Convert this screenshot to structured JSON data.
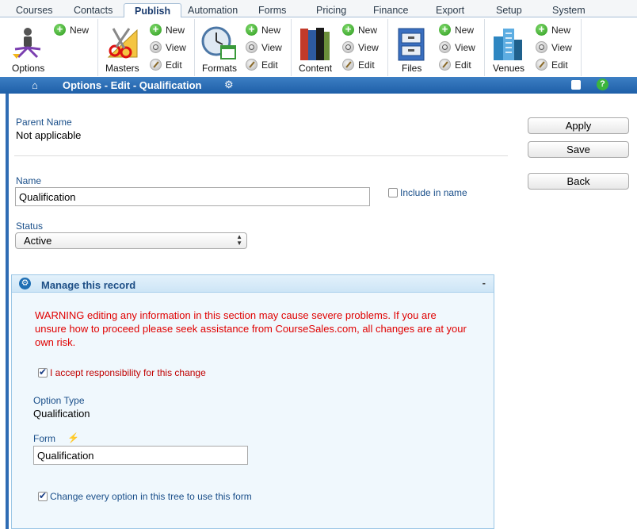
{
  "topnav": [
    {
      "label": "Courses",
      "active": false
    },
    {
      "label": "Contacts",
      "active": false
    },
    {
      "label": "Publish",
      "active": true
    },
    {
      "label": "Automation",
      "active": false
    },
    {
      "label": "Forms",
      "active": false
    },
    {
      "label": "Pricing",
      "active": false
    },
    {
      "label": "Finance",
      "active": false
    },
    {
      "label": "Export",
      "active": false
    },
    {
      "label": "Setup",
      "active": false
    },
    {
      "label": "System",
      "active": false
    }
  ],
  "ribbon": {
    "options": {
      "label": "Options",
      "new": "New"
    },
    "masters": {
      "label": "Masters",
      "new": "New",
      "view": "View",
      "edit": "Edit"
    },
    "formats": {
      "label": "Formats",
      "new": "New",
      "view": "View",
      "edit": "Edit"
    },
    "content": {
      "label": "Content",
      "new": "New",
      "view": "View",
      "edit": "Edit"
    },
    "files": {
      "label": "Files",
      "new": "New",
      "view": "View",
      "edit": "Edit"
    },
    "venues": {
      "label": "Venues",
      "new": "New",
      "view": "View",
      "edit": "Edit"
    }
  },
  "titlebar": {
    "title": "Options - Edit - Qualification"
  },
  "form": {
    "parent_label": "Parent Name",
    "parent_value": "Not applicable",
    "name_label": "Name",
    "name_value": "Qualification",
    "include_label": "Include in name",
    "include_checked": false,
    "status_label": "Status",
    "status_value": "Active"
  },
  "buttons": {
    "apply": "Apply",
    "save": "Save",
    "back": "Back"
  },
  "manage": {
    "title": "Manage this record",
    "collapse": "-",
    "warning": "WARNING editing any information in this section may cause severe problems. If you are unsure how to proceed please seek assistance from CourseSales.com, all changes are at your own risk.",
    "accept_label": "I accept responsibility for this change",
    "accept_checked": true,
    "option_type_label": "Option Type",
    "option_type_value": "Qualification",
    "form_label": "Form",
    "form_value": "Qualification",
    "change_tree_label": "Change every option in this tree to use this form",
    "change_tree_checked": true
  },
  "colors": {
    "titlebar": "#1e5fa8",
    "label": "#1a4f8a",
    "warning": "#e00000",
    "panel_bg": "#f0f8fd"
  }
}
